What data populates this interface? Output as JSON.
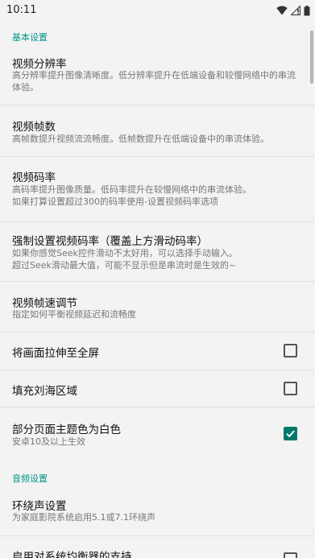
{
  "status": {
    "time": "10:11",
    "icons": [
      "wifi-icon",
      "sim-no-service-icon",
      "battery-icon"
    ]
  },
  "sections": {
    "basic": {
      "title": "基本设置"
    },
    "audio": {
      "title": "音频设置"
    }
  },
  "items": {
    "resolution": {
      "title": "视频分辨率",
      "summary": "高分辨率提升图像清晰度。低分辨率提升在低端设备和较慢网络中的串流体验。"
    },
    "fps": {
      "title": "视频帧数",
      "summary": "高帧数提升视频流流畅度。低帧数提升在低端设备中的串流体验。"
    },
    "bitrate": {
      "title": "视频码率",
      "summary1": "高码率提升图像质量。低码率提升在较慢网络中的串流体验。",
      "summary2": "如果打算设置超过300的码率使用-设置视频码率选项"
    },
    "force_bitrate": {
      "title": "强制设置视频码率（覆盖上方滑动码率）",
      "summary1": "如果你感觉Seek控件滑动不太好用，可以选择手动输入。",
      "summary2": "超过Seek滑动最大值，可能不显示但是串流时是生效的~"
    },
    "pacing": {
      "title": "视频帧速调节",
      "summary": "指定如何平衡视频延迟和流畅度"
    },
    "stretch": {
      "title": "将画面拉伸至全屏",
      "checked": false
    },
    "notch": {
      "title": "填充刘海区域",
      "checked": false
    },
    "white_theme": {
      "title": "部分页面主题色为白色",
      "summary": "安卓10及以上生效",
      "checked": true
    },
    "surround": {
      "title": "环绕声设置",
      "summary": "为家庭影院系统启用5.1或7.1环绕声"
    },
    "equalizer": {
      "title": "启用对系统均衡器的支持"
    }
  },
  "colors": {
    "accent": "#009688",
    "checkbox_checked": "#00796b",
    "background": "#f3f3f3"
  }
}
